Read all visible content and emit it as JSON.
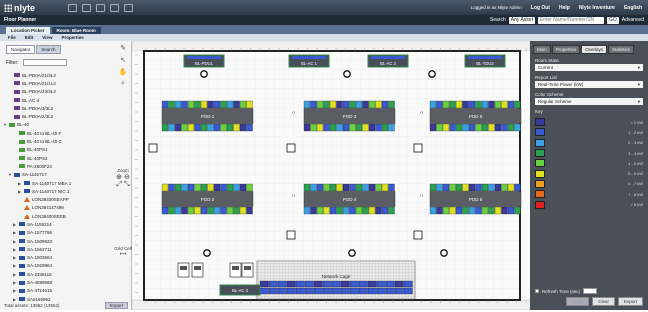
{
  "app": {
    "logo": "nlyte",
    "title": "Floor Planner"
  },
  "top_links": {
    "user": "Logged in as Nlyte Admin",
    "logout": "Log Out",
    "help": "Help",
    "nlyte_inventure": "Nlyte Inventure",
    "language": "English"
  },
  "search": {
    "label": "Search",
    "scope": "Any Asset",
    "placeholder": "Enter Name/Number/SN",
    "go": "GO",
    "advanced": "Advanced"
  },
  "location_tabs": [
    "Location Picker",
    "Room: Blue Room"
  ],
  "menu": [
    "File",
    "Edit",
    "View",
    "Properties"
  ],
  "left_panel": {
    "tabs": [
      "Navigator",
      "Search"
    ],
    "filter_label": "Filter:",
    "tree": [
      {
        "label": "BL-PD0A/21/3L3",
        "icon": "rack",
        "indent": 1
      },
      {
        "label": "BL-PD0A/21/1L3",
        "icon": "rack",
        "indent": 1
      },
      {
        "label": "BL-PD0A/23/3L3",
        "icon": "rack",
        "indent": 1
      },
      {
        "label": "BL-AC 4",
        "icon": "rack",
        "indent": 1
      },
      {
        "label": "BL-PD0A/3/3L2",
        "icon": "rack",
        "indent": 1
      },
      {
        "label": "BL-PD0A/2/3L2",
        "icon": "rack",
        "indent": 1
      },
      {
        "label": "BL-40",
        "icon": "green",
        "indent": 0,
        "expand": "▼"
      },
      {
        "label": "BL-40 to BL-40 F",
        "icon": "green",
        "indent": 2
      },
      {
        "label": "BL-40 to BL-40 C",
        "icon": "green",
        "indent": 2
      },
      {
        "label": "BL-40PS1",
        "icon": "green",
        "indent": 2
      },
      {
        "label": "BL-40PS2",
        "icon": "green",
        "indent": 2
      },
      {
        "label": "PA-2800F24",
        "icon": "green",
        "indent": 2
      },
      {
        "label": "SA-1140717",
        "icon": "blue",
        "indent": 1,
        "expand": "▼"
      },
      {
        "label": "SA-1140717 MBA 1",
        "icon": "blue",
        "indent": 3,
        "expand": "▶"
      },
      {
        "label": "SA-1140717 NIC 1",
        "icon": "blue",
        "indent": 3,
        "expand": "▶"
      },
      {
        "label": "LON38400SEAPP",
        "icon": "tri",
        "indent": 3
      },
      {
        "label": "LON384147499",
        "icon": "tri",
        "indent": 3
      },
      {
        "label": "LON38400SEEB",
        "icon": "tri",
        "indent": 3
      },
      {
        "label": "SA-1155214",
        "icon": "blue",
        "indent": 2,
        "expand": "▶"
      },
      {
        "label": "SA-1577796",
        "icon": "blue",
        "indent": 2,
        "expand": "▶"
      },
      {
        "label": "SA-1609923",
        "icon": "blue",
        "indent": 2,
        "expand": "▶"
      },
      {
        "label": "SA-1662711",
        "icon": "blue",
        "indent": 2,
        "expand": "▶"
      },
      {
        "label": "SA-1903564",
        "icon": "blue",
        "indent": 2,
        "expand": "▶"
      },
      {
        "label": "SA-1929964",
        "icon": "blue",
        "indent": 2,
        "expand": "▶"
      },
      {
        "label": "SA-2338118",
        "icon": "blue",
        "indent": 2,
        "expand": "▶"
      },
      {
        "label": "SA-4599568",
        "icon": "blue",
        "indent": 2,
        "expand": "▶"
      },
      {
        "label": "SA-4714615",
        "icon": "blue",
        "indent": 2,
        "expand": "▶"
      },
      {
        "label": "SA5165962",
        "icon": "blue",
        "indent": 2,
        "expand": "▶"
      }
    ],
    "total": "Total assets: 13552 (13552)",
    "export": "Export"
  },
  "tools": {
    "zoom_label": "Zoom",
    "grid_label": "Grid Cell"
  },
  "floor": {
    "top_units": [
      "BL-PDU1",
      "BL-AC 1",
      "BL-AC 2",
      "BL-TDU2"
    ],
    "pods": [
      "POD 1",
      "POD 3",
      "POD 5",
      "POD 2",
      "POD 4",
      "POD 6"
    ],
    "cage_label": "Network Cage",
    "bottom_unit": "BL-AC 3"
  },
  "right_panel": {
    "tabs": [
      "Main",
      "Properties",
      "Overlays",
      "Statistics"
    ],
    "room_state_label": "Room State",
    "room_state": "Current",
    "report_label": "Report List",
    "report": "Real-Time Power (kW)",
    "scheme_label": "Color Scheme",
    "scheme": "Regular Scheme",
    "key_label": "Key",
    "legend": [
      {
        "color": "#3a3a9a",
        "label": "< 1 kW"
      },
      {
        "color": "#3a5ad0",
        "label": "1 - 2 kW"
      },
      {
        "color": "#3aa0e0",
        "label": "2 - 3 kW"
      },
      {
        "color": "#2aa050",
        "label": "3 - 4 kW"
      },
      {
        "color": "#6ad040",
        "label": "4 - 5 kW"
      },
      {
        "color": "#e0e020",
        "label": "5 - 6 kW"
      },
      {
        "color": "#f0a020",
        "label": "6 - 7 kW"
      },
      {
        "color": "#e86a20",
        "label": "7 - 8 kW"
      },
      {
        "color": "#e02020",
        "label": "> 8 kW"
      }
    ],
    "refresh_label": "Refresh Time (sec)",
    "apply": "Apply",
    "clear": "Clear",
    "export": "Export"
  }
}
